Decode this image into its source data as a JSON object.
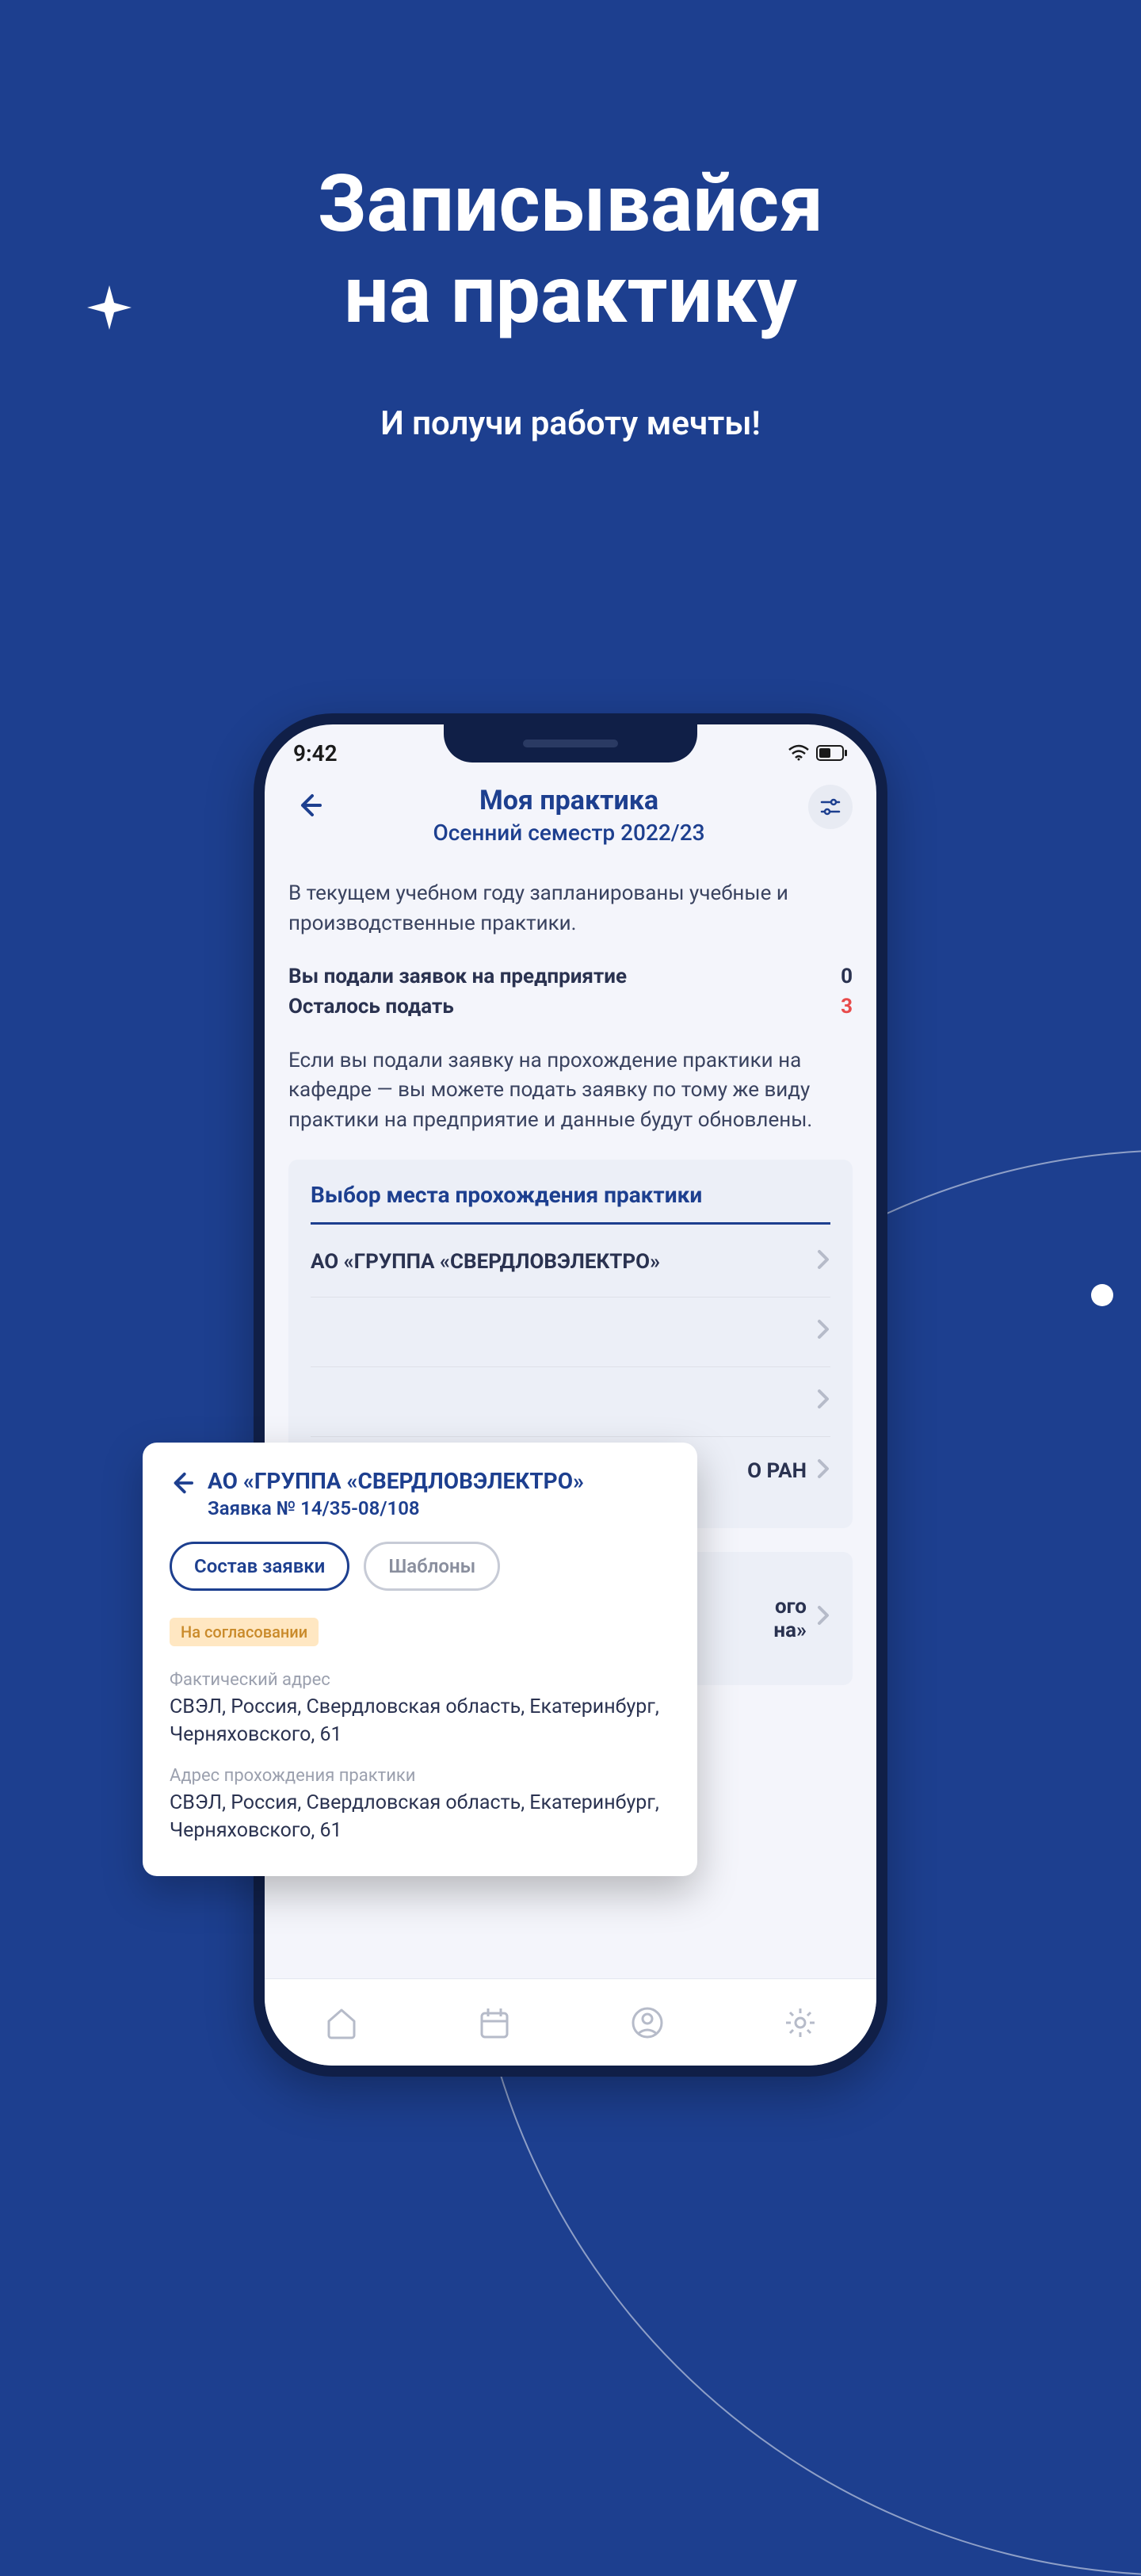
{
  "promo": {
    "title_line1": "Записывайся",
    "title_line2": "на практику",
    "subtitle": "И получи работу мечты!"
  },
  "status": {
    "time": "9:42"
  },
  "header": {
    "title": "Моя практика",
    "subtitle": "Осенний семестр 2022/23"
  },
  "info": {
    "planned_text": "В текущем учебном году запланированы учебные и производственные практики.",
    "submitted_label": "Вы подали заявок на предприятие",
    "submitted_count": "0",
    "remaining_label": "Осталось подать",
    "remaining_count": "3",
    "hint_text": "Если вы подали заявку на прохождение практики на кафедре — вы можете подать заявку по тому же виду практики на предприятие и данные будут обновлены."
  },
  "section1": {
    "title": "Выбор места прохождения практики",
    "items": [
      "АО «ГРУППА «СВЕРДЛОВЭЛЕКТРО»",
      "",
      "",
      "О РАН"
    ]
  },
  "section2": {
    "items": [
      "ого\nна»"
    ]
  },
  "detail": {
    "title": "АО «ГРУППА «СВЕРДЛОВЭЛЕКТРО»",
    "subtitle": "Заявка № 14/35-08/108",
    "tab_active": "Состав заявки",
    "tab_inactive": "Шаблоны",
    "badge": "На согласовании",
    "addr1_label": "Фактический адрес",
    "addr1_value": "СВЭЛ, Россия, Свердловская область, Екатеринбург, Черняховского, 61",
    "addr2_label": "Адрес прохождения практики",
    "addr2_value": "СВЭЛ, Россия, Свердловская область, Екатеринбург, Черняховского, 61"
  }
}
